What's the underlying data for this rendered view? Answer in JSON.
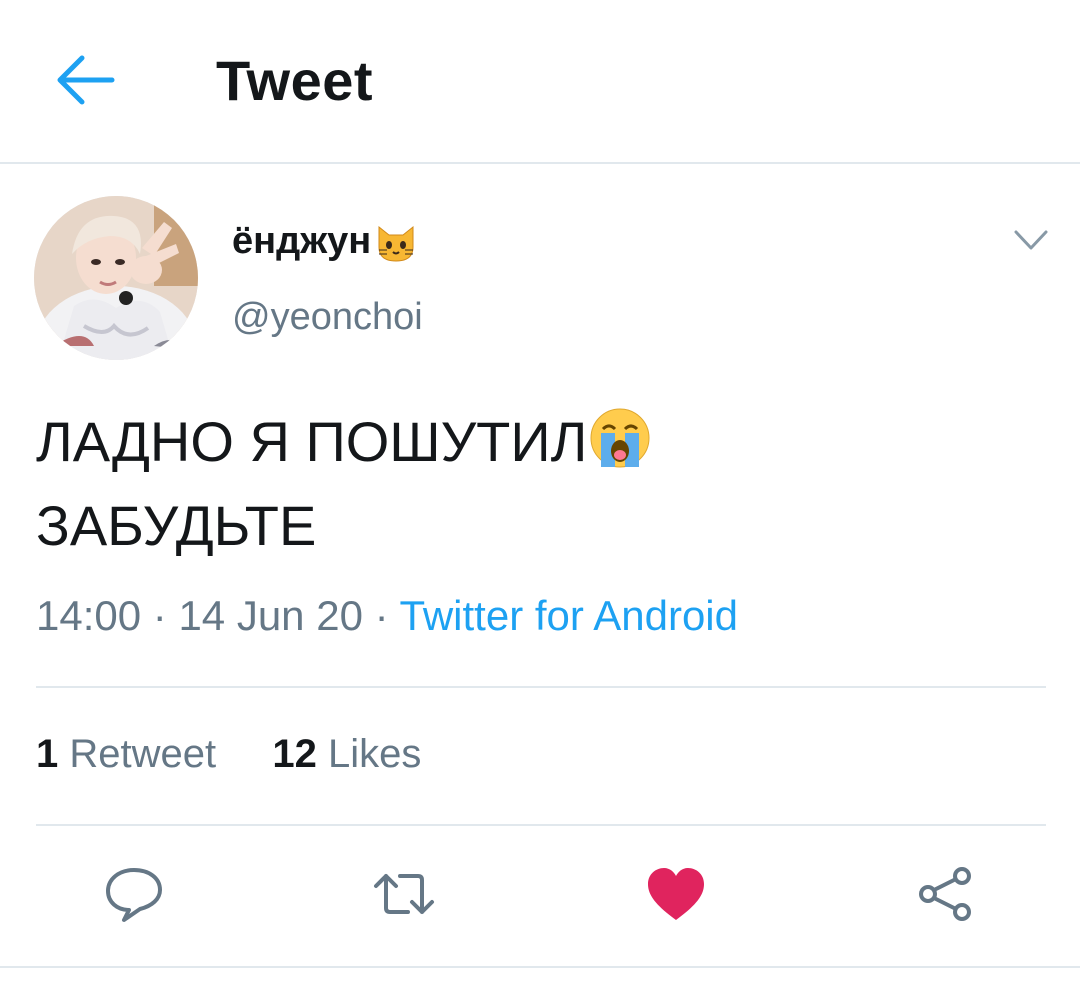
{
  "header": {
    "title": "Tweet"
  },
  "tweet": {
    "author_name": "ёнджун",
    "handle": "@yeonchoi",
    "text_line1": "ЛАДНО Я ПОШУТИЛ",
    "text_line2": "ЗАБУДЬТЕ",
    "time": "14:00",
    "date": "14 Jun 20",
    "separator": " · ",
    "source": "Twitter for Android"
  },
  "stats": {
    "retweets_count": "1",
    "retweets_label": "Retweet",
    "likes_count": "12",
    "likes_label": "Likes"
  },
  "icons": {
    "back": "arrow-left-icon",
    "caret": "chevron-down-icon",
    "reply": "reply-icon",
    "retweet": "retweet-icon",
    "like": "heart-icon",
    "share": "share-icon"
  },
  "colors": {
    "accent": "#1da1f2",
    "like": "#e0245e",
    "secondary_text": "#657786",
    "divider": "#e1e8ed"
  }
}
